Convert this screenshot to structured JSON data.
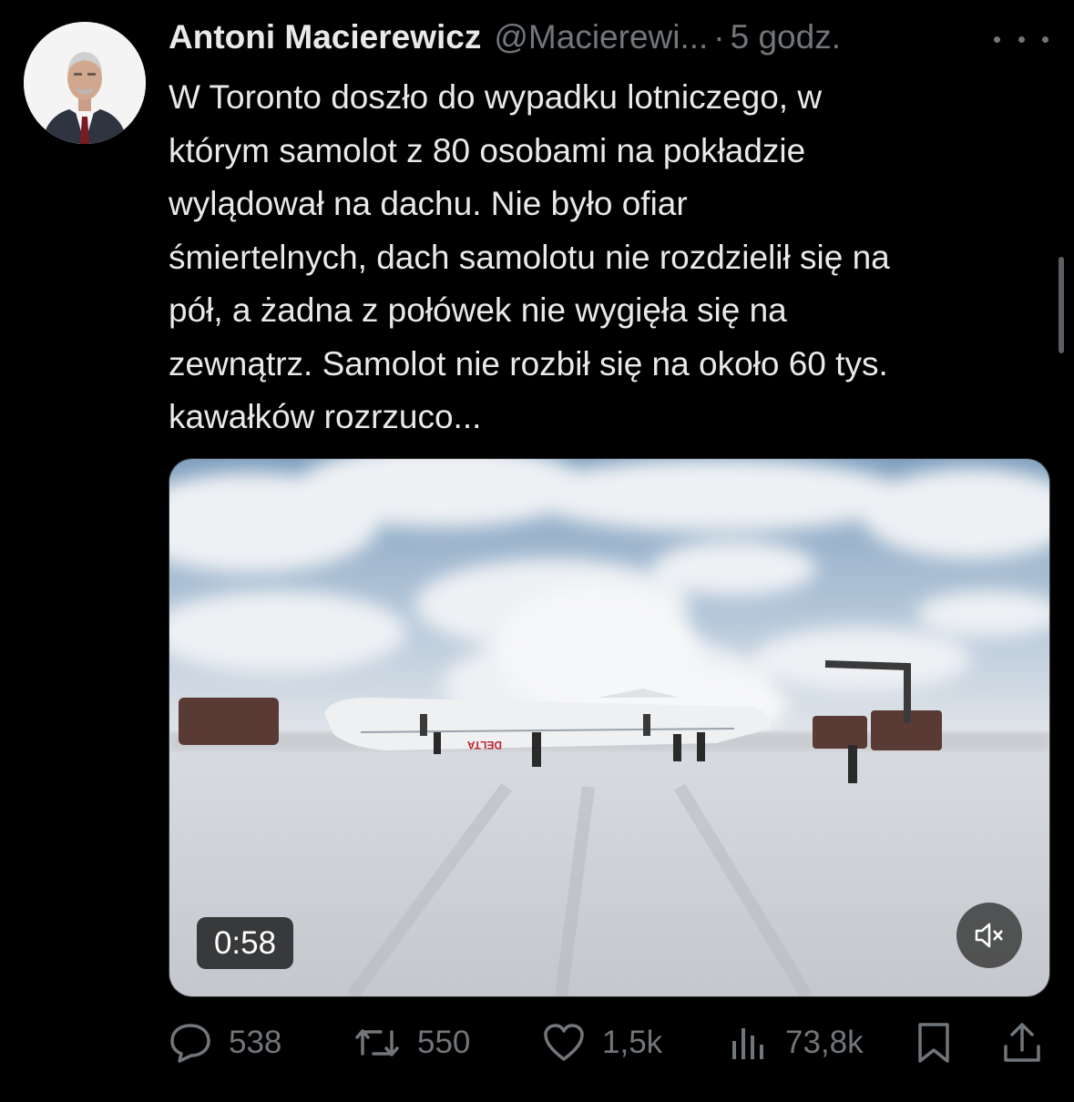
{
  "author": {
    "name": "Antoni Macierewicz",
    "handle": "@Macierewi...",
    "separator": "·",
    "time": "5 godz."
  },
  "tweet": {
    "text": "W Toronto doszło do wypadku lotniczego, w\nktórym samolot z 80 osobami na pokładzie\nwylądował na dachu. Nie było ofiar\nśmiertelnych, dach samolotu nie rozdzielił się na\npół, a żadna z połówek nie wygięła się na\nzewnątrz. Samolot nie rozbił się na około 60 tys.\nkawałków rozrzuco..."
  },
  "video": {
    "duration": "0:58",
    "fuselage_text": "DELTA"
  },
  "actions": {
    "replies": "538",
    "reposts": "550",
    "likes": "1,5k",
    "views": "73,8k"
  },
  "colors": {
    "background": "#000000",
    "text": "#e7e9ea",
    "muted": "#71767b"
  },
  "icons": [
    "more-icon",
    "reply-icon",
    "repost-icon",
    "like-icon",
    "views-icon",
    "bookmark-icon",
    "share-icon",
    "mute-icon"
  ]
}
